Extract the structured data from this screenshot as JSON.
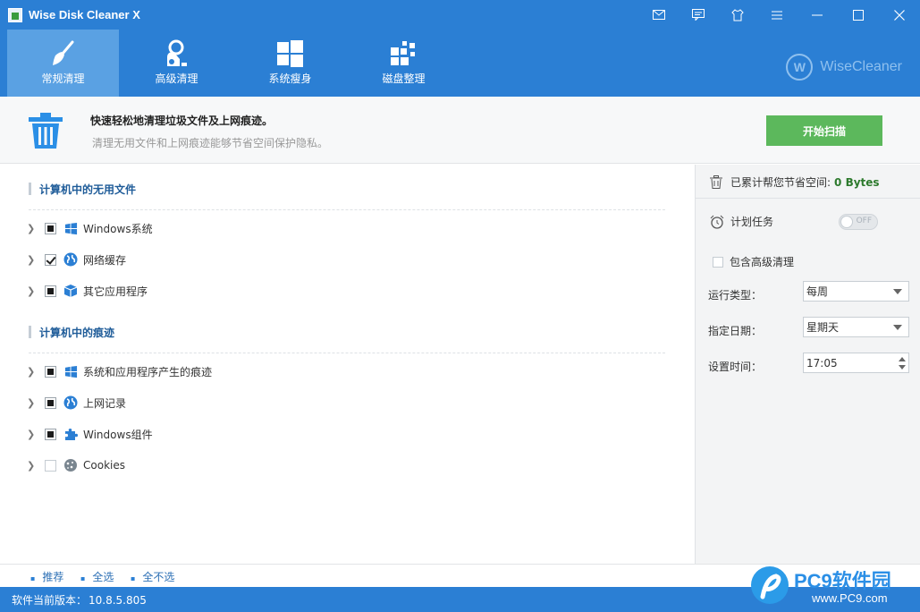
{
  "window": {
    "title": "Wise Disk Cleaner X",
    "controls": [
      "mail-icon",
      "feedback-icon",
      "skin-icon",
      "menu-icon",
      "minimize-icon",
      "maximize-icon",
      "close-icon"
    ]
  },
  "tabs": [
    {
      "label": "常规清理",
      "icon": "broom-icon",
      "active": true
    },
    {
      "label": "高级清理",
      "icon": "vacuum-icon",
      "active": false
    },
    {
      "label": "系统瘦身",
      "icon": "windows-logo-icon",
      "active": false
    },
    {
      "label": "磁盘整理",
      "icon": "defrag-blocks-icon",
      "active": false
    }
  ],
  "brand": {
    "mark": "W",
    "name": "WiseCleaner"
  },
  "banner": {
    "headline": "快速轻松地清理垃圾文件及上网痕迹。",
    "subline": "清理无用文件和上网痕迹能够节省空间保护隐私。",
    "scan_button": "开始扫描"
  },
  "sections": [
    {
      "title": "计算机中的无用文件",
      "items": [
        {
          "label": "Windows系统",
          "check": "partial",
          "icon": "windows-icon"
        },
        {
          "label": "网络缓存",
          "check": "checked",
          "icon": "globe-icon"
        },
        {
          "label": "其它应用程序",
          "check": "partial",
          "icon": "package-icon"
        }
      ]
    },
    {
      "title": "计算机中的痕迹",
      "items": [
        {
          "label": "系统和应用程序产生的痕迹",
          "check": "partial",
          "icon": "windows-icon"
        },
        {
          "label": "上网记录",
          "check": "partial",
          "icon": "globe-icon"
        },
        {
          "label": "Windows组件",
          "check": "partial",
          "icon": "puzzle-icon"
        },
        {
          "label": "Cookies",
          "check": "empty",
          "icon": "cookie-icon"
        }
      ]
    }
  ],
  "side": {
    "saved_label": "已累计帮您节省空间:",
    "saved_value": "0 Bytes",
    "schedule_label": "计划任务",
    "toggle_text": "OFF",
    "include_advanced": "包含高级清理",
    "run_type_label": "运行类型：",
    "run_type_value": "每周",
    "day_label": "指定日期：",
    "day_value": "星期天",
    "time_label": "设置时间：",
    "time_value": "17:05"
  },
  "bottom_links": [
    "推荐",
    "全选",
    "全不选"
  ],
  "status": {
    "version_label": "软件当前版本：",
    "version": "10.8.5.805"
  },
  "watermark": {
    "logo": "PC9软件园",
    "url": "www.PC9.com"
  },
  "colors": {
    "primary": "#2b7fd4",
    "active_tab": "#5aa1e3",
    "scan_button": "#5cb85c",
    "saved_value": "#2d7a2d"
  }
}
